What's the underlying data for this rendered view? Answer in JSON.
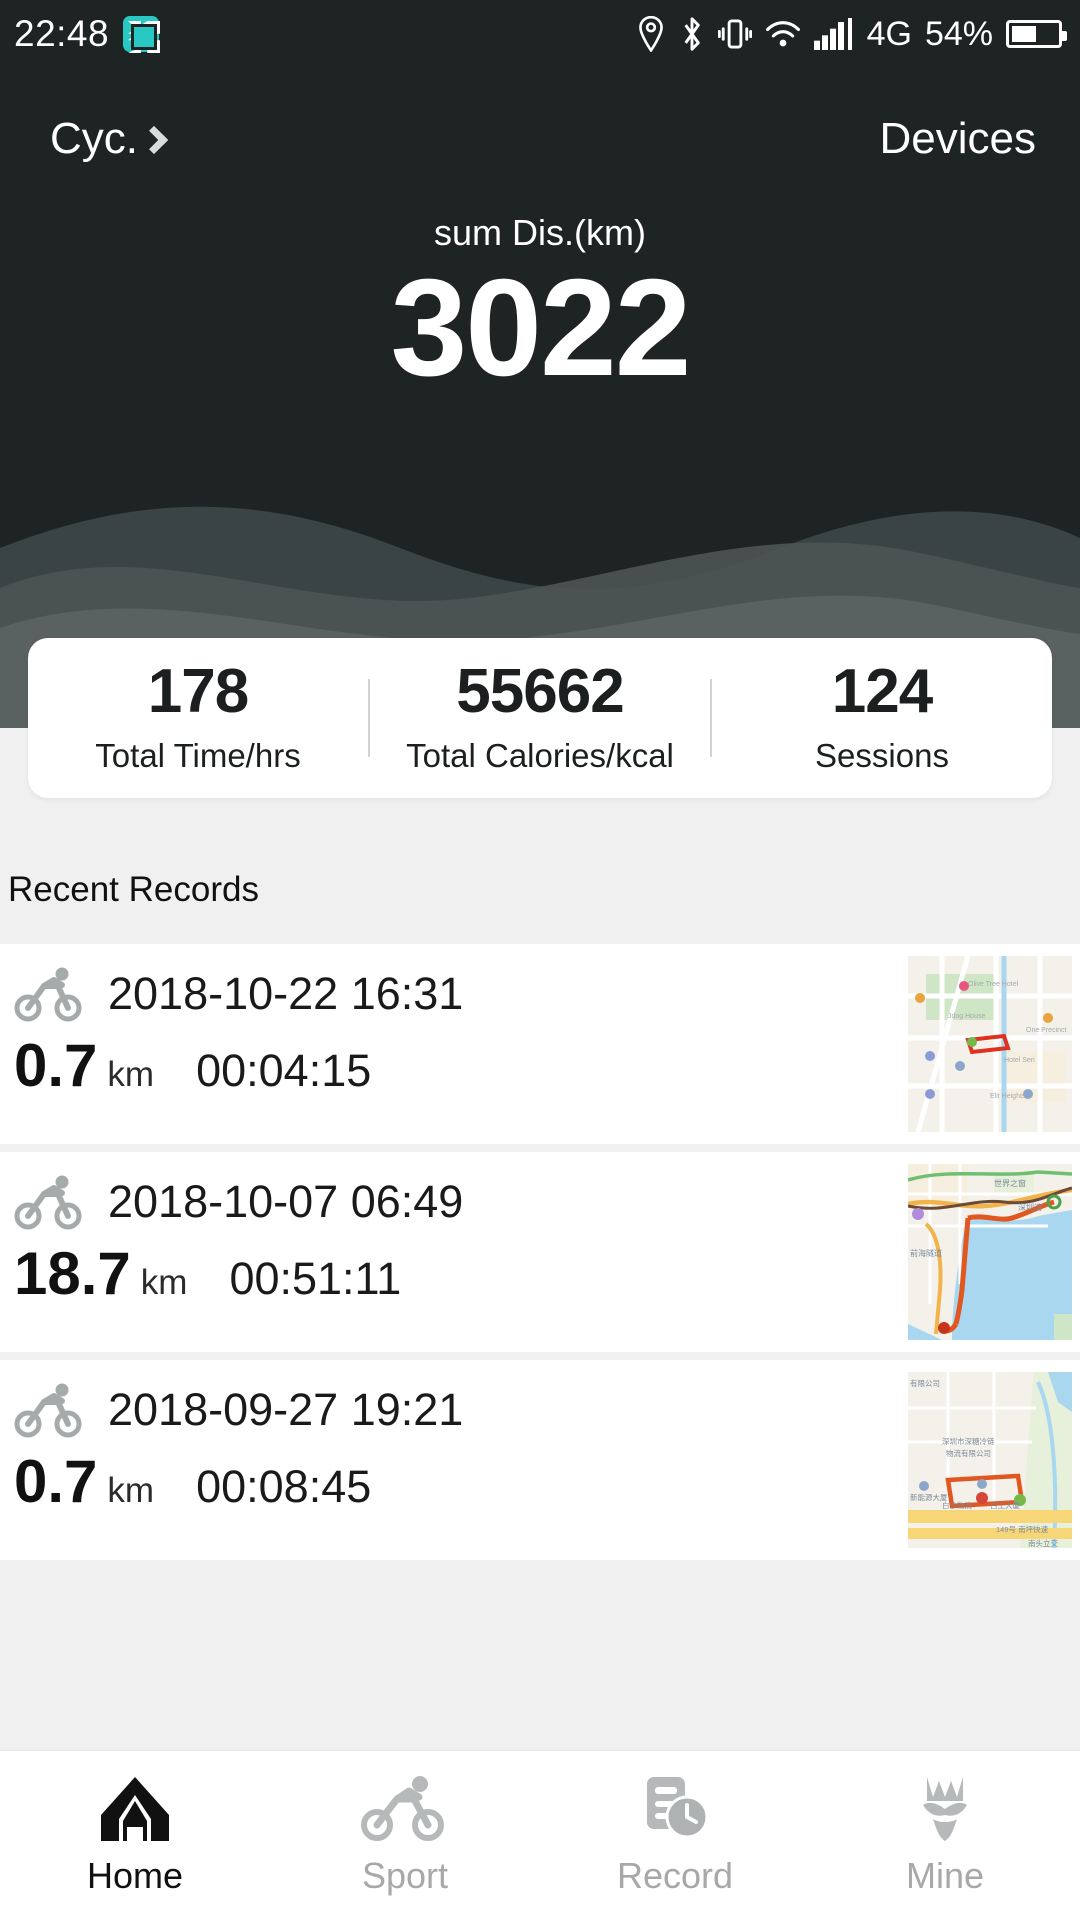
{
  "status_bar": {
    "time": "22:48",
    "capture_icon": "screenshot-capture-icon",
    "icons": [
      "location-icon",
      "bluetooth-icon",
      "vibrate-icon",
      "wifi-icon",
      "signal-bars-icon"
    ],
    "network": "4G",
    "battery_percent": "54%",
    "battery_level": 54,
    "accent_color": "#27c9c2",
    "background_color": "#1e2424"
  },
  "header": {
    "sport_type": "Cyc.",
    "chevron_icon": "chevron-right-icon",
    "devices_label": "Devices",
    "summary_label": "sum Dis.(km)",
    "summary_value": "3022"
  },
  "stats": [
    {
      "value": "178",
      "label": "Total Time/hrs"
    },
    {
      "value": "55662",
      "label": "Total Calories/kcal"
    },
    {
      "value": "124",
      "label": "Sessions"
    }
  ],
  "recent": {
    "section_title": "Recent Records",
    "records": [
      {
        "icon": "cyclist-icon",
        "datetime": "2018-10-22 16:31",
        "distance": "0.7",
        "unit": "km",
        "duration": "00:04:15",
        "map_thumbnail": "route-map-thumbnail"
      },
      {
        "icon": "cyclist-icon",
        "datetime": "2018-10-07 06:49",
        "distance": "18.7",
        "unit": "km",
        "duration": "00:51:11",
        "map_thumbnail": "route-map-thumbnail"
      },
      {
        "icon": "cyclist-icon",
        "datetime": "2018-09-27 19:21",
        "distance": "0.7",
        "unit": "km",
        "duration": "00:08:45",
        "map_thumbnail": "route-map-thumbnail"
      }
    ]
  },
  "tabbar": {
    "items": [
      {
        "label": "Home",
        "icon": "home-icon",
        "active": true
      },
      {
        "label": "Sport",
        "icon": "cyclist-icon",
        "active": false
      },
      {
        "label": "Record",
        "icon": "record-clock-icon",
        "active": false
      },
      {
        "label": "Mine",
        "icon": "person-icon",
        "active": false
      }
    ]
  }
}
